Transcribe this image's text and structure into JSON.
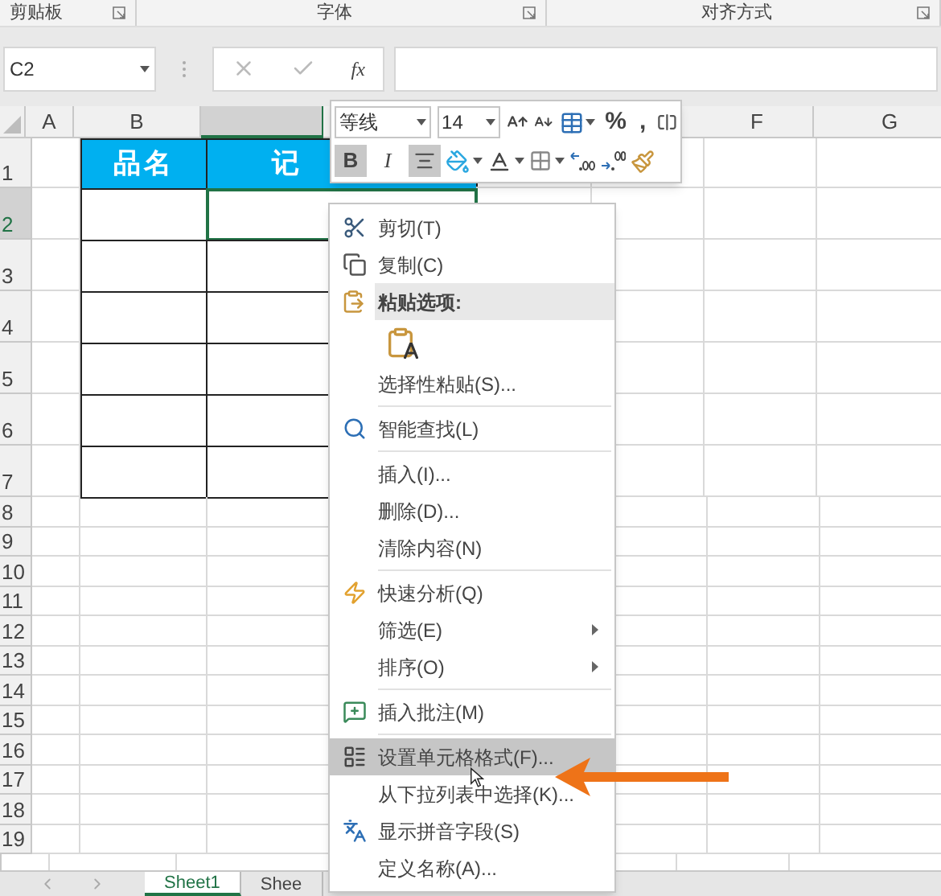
{
  "ribbon_groups": [
    {
      "label": "剪贴板"
    },
    {
      "label": "字体"
    },
    {
      "label": "对齐方式"
    }
  ],
  "name_box": {
    "value": "C2"
  },
  "formula_bar": {
    "fx_label": "fx"
  },
  "column_headers": [
    {
      "label": "A",
      "selected": false
    },
    {
      "label": "B",
      "selected": false
    },
    {
      "selected": true
    },
    {
      "label": "F",
      "selected": false
    },
    {
      "label": "G",
      "selected": false
    }
  ],
  "row_headers": [
    {
      "label": "1",
      "selected": false
    },
    {
      "label": "2",
      "selected": true
    },
    {
      "label": "3",
      "selected": false
    },
    {
      "label": "4",
      "selected": false
    },
    {
      "label": "5",
      "selected": false
    },
    {
      "label": "6",
      "selected": false
    },
    {
      "label": "7",
      "selected": false
    },
    {
      "label": "8",
      "selected": false
    },
    {
      "label": "9",
      "selected": false
    },
    {
      "label": "10",
      "selected": false
    },
    {
      "label": "11",
      "selected": false
    },
    {
      "label": "12",
      "selected": false
    },
    {
      "label": "13",
      "selected": false
    },
    {
      "label": "14",
      "selected": false
    },
    {
      "label": "15",
      "selected": false
    },
    {
      "label": "16",
      "selected": false
    },
    {
      "label": "17",
      "selected": false
    },
    {
      "label": "18",
      "selected": false
    },
    {
      "label": "19",
      "selected": false
    }
  ],
  "table": {
    "headers": [
      "品名",
      "记"
    ]
  },
  "mini_toolbar": {
    "font": "等线",
    "size": "14",
    "row_1": [
      {
        "kind": "grow-font"
      },
      {
        "kind": "shrink-font"
      },
      {
        "kind": "cell-style"
      },
      {
        "kind": "text",
        "label": "%"
      },
      {
        "kind": "text",
        "label": ","
      },
      {
        "kind": "wrap"
      }
    ],
    "row_2": [
      {
        "kind": "toggle",
        "label": "B",
        "selected": true
      },
      {
        "kind": "toggle-italic",
        "label": "I",
        "selected": false
      },
      {
        "kind": "toggle-align",
        "selected": true
      },
      {
        "kind": "fill"
      },
      {
        "kind": "font-color"
      },
      {
        "kind": "borders"
      },
      {
        "kind": "add-decimal"
      },
      {
        "kind": "remove-decimal"
      },
      {
        "kind": "painter"
      }
    ]
  },
  "context_menu": [
    {
      "kind": "item",
      "label": "剪切(T)",
      "selected": false,
      "submenu": false
    },
    {
      "kind": "item",
      "label": "复制(C)",
      "selected": false,
      "submenu": false
    },
    {
      "kind": "header",
      "label": "粘贴选项:"
    },
    {
      "kind": "paste-icon"
    },
    {
      "kind": "item",
      "label": "选择性粘贴(S)...",
      "selected": false,
      "submenu": false
    },
    {
      "kind": "separator"
    },
    {
      "kind": "item",
      "label": "智能查找(L)",
      "selected": false,
      "submenu": false
    },
    {
      "kind": "separator"
    },
    {
      "kind": "item",
      "label": "插入(I)...",
      "selected": false,
      "submenu": false
    },
    {
      "kind": "item",
      "label": "删除(D)...",
      "selected": false,
      "submenu": false
    },
    {
      "kind": "item",
      "label": "清除内容(N)",
      "selected": false,
      "submenu": false
    },
    {
      "kind": "separator"
    },
    {
      "kind": "item",
      "label": "快速分析(Q)",
      "selected": false,
      "submenu": false
    },
    {
      "kind": "item",
      "label": "筛选(E)",
      "selected": false,
      "submenu": true
    },
    {
      "kind": "item",
      "label": "排序(O)",
      "selected": false,
      "submenu": true
    },
    {
      "kind": "separator"
    },
    {
      "kind": "item",
      "label": "插入批注(M)",
      "selected": false,
      "submenu": false
    },
    {
      "kind": "separator"
    },
    {
      "kind": "item",
      "label": "设置单元格格式(F)...",
      "selected": true,
      "submenu": false
    },
    {
      "kind": "item",
      "label": "从下拉列表中选择(K)...",
      "selected": false,
      "submenu": false
    },
    {
      "kind": "item",
      "label": "显示拼音字段(S)",
      "selected": false,
      "submenu": false
    },
    {
      "kind": "item",
      "label": "定义名称(A)...",
      "selected": false,
      "submenu": false
    }
  ],
  "sheet_tabs": [
    {
      "label": "Sheet1",
      "selected": true
    },
    {
      "label": "Shee",
      "selected": false
    }
  ]
}
